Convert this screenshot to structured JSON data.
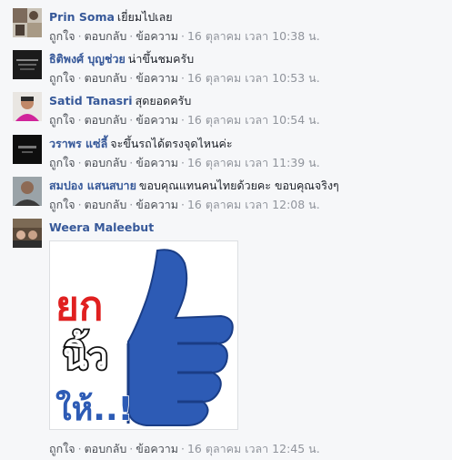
{
  "actions": {
    "like": "ถูกใจ",
    "reply": "ตอบกลับ",
    "message": "ข้อความ",
    "separator": "·"
  },
  "comments": [
    {
      "author": "Prin Soma",
      "text": "เยี่ยมไปเลย",
      "time": "16 ตุลาคม เวลา 10:38 น."
    },
    {
      "author": "ธิติพงศ์ บุญช่วย",
      "text": "น่าขึ้นชมครับ",
      "time": "16 ตุลาคม เวลา 10:53 น."
    },
    {
      "author": "Satid Tanasri",
      "text": "สุดยอดครับ",
      "time": "16 ตุลาคม เวลา 10:54 น."
    },
    {
      "author": "วราพร แซ่ลี้",
      "text": "จะขึ้นรถได้ตรงจุดไหนค่ะ",
      "time": "16 ตุลาคม เวลา 11:39 น."
    },
    {
      "author": "สมปอง แสนสบาย",
      "text": "ขอบคุณแทนคนไทยด้วยคะ ขอบคุณจริงๆ",
      "time": "16 ตุลาคม เวลา 12:08 น."
    },
    {
      "author": "Weera Maleebut",
      "text": "",
      "time": "16 ตุลาคม เวลา 12:45 น.",
      "sticker_text": [
        "ยก",
        "นิ้ว",
        "ให้..!"
      ]
    }
  ],
  "colors": {
    "author": "#365899",
    "meta": "#90949c",
    "sticker_blue": "#2d5bb5",
    "sticker_red": "#e02020"
  }
}
